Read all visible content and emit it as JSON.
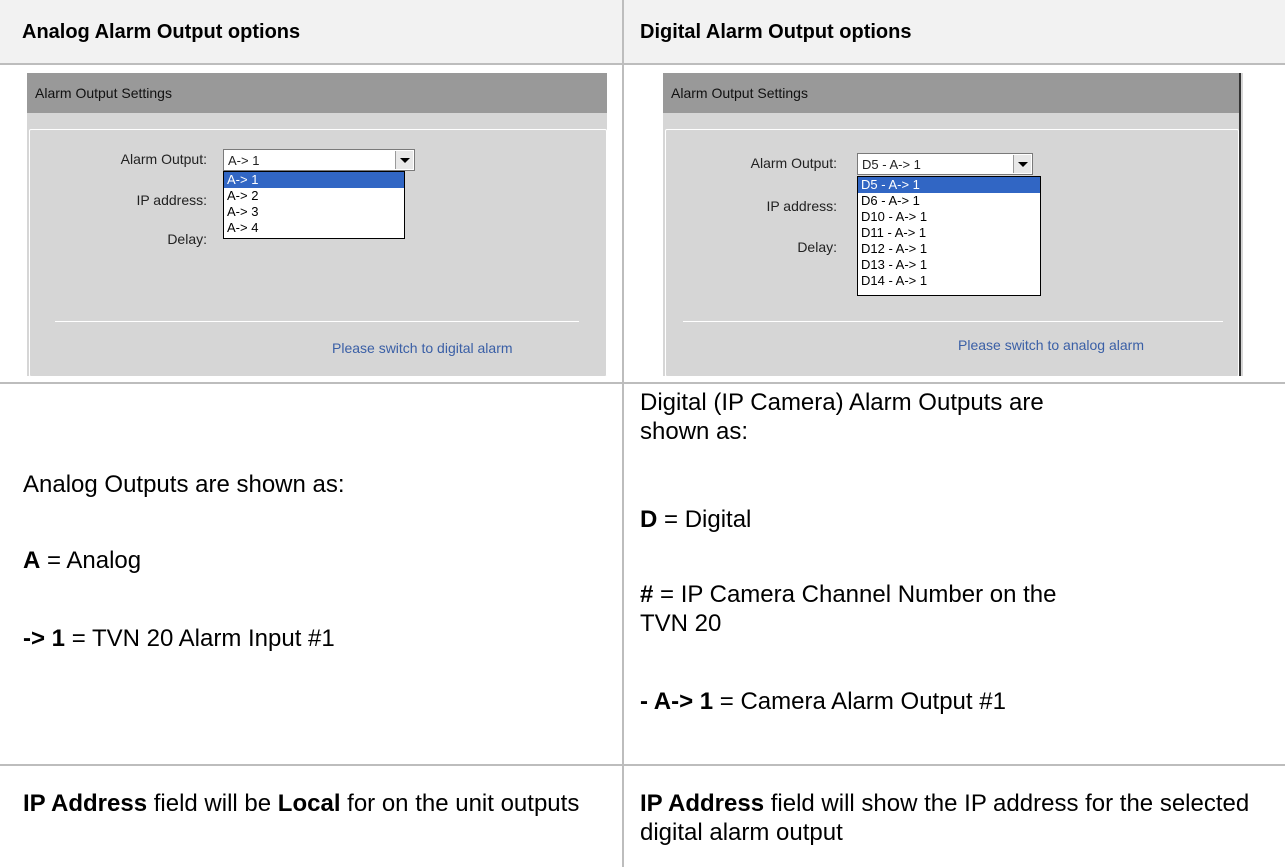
{
  "headers": {
    "left": "Analog Alarm Output options",
    "right": "Digital Alarm Output options"
  },
  "analog_panel": {
    "title": "Alarm Output Settings",
    "alarm_output_label": "Alarm Output:",
    "ip_address_label": "IP address:",
    "delay_label": "Delay:",
    "selected_value": "A-> 1",
    "options": [
      "A-> 1",
      "A-> 2",
      "A-> 3",
      "A-> 4"
    ],
    "link": "Please switch to digital alarm"
  },
  "digital_panel": {
    "title": "Alarm Output Settings",
    "alarm_output_label": "Alarm Output:",
    "ip_address_label": "IP address:",
    "delay_label": "Delay:",
    "selected_value": "D5 - A-> 1",
    "options": [
      "D5 - A-> 1",
      "D6 - A-> 1",
      "D10 - A-> 1",
      "D11 - A-> 1",
      "D12 - A-> 1",
      "D13 - A-> 1",
      "D14 - A-> 1"
    ],
    "link": "Please switch to analog alarm"
  },
  "analog_desc": {
    "intro": "Analog Outputs are shown as:",
    "a_key": "A",
    "a_desc": " = Analog",
    "arrow_key": "-> 1",
    "arrow_desc": " = TVN 20 Alarm Input #1"
  },
  "digital_desc": {
    "intro": "Digital (IP Camera) Alarm Outputs are shown as:",
    "d_key": "D",
    "d_desc": " = Digital",
    "hash_key": "#",
    "hash_desc": " = IP Camera Channel Number on the TVN 20",
    "a_key": "- A-> 1",
    "a_desc": " = Camera Alarm Output #1"
  },
  "ip_row": {
    "left_b1": "IP Address",
    "left_t1": " field will be ",
    "left_b2": "Local",
    "left_t2": " for on the unit outputs",
    "right_b1": "IP Address",
    "right_t1": " field will show the IP address for the selected digital alarm output"
  }
}
